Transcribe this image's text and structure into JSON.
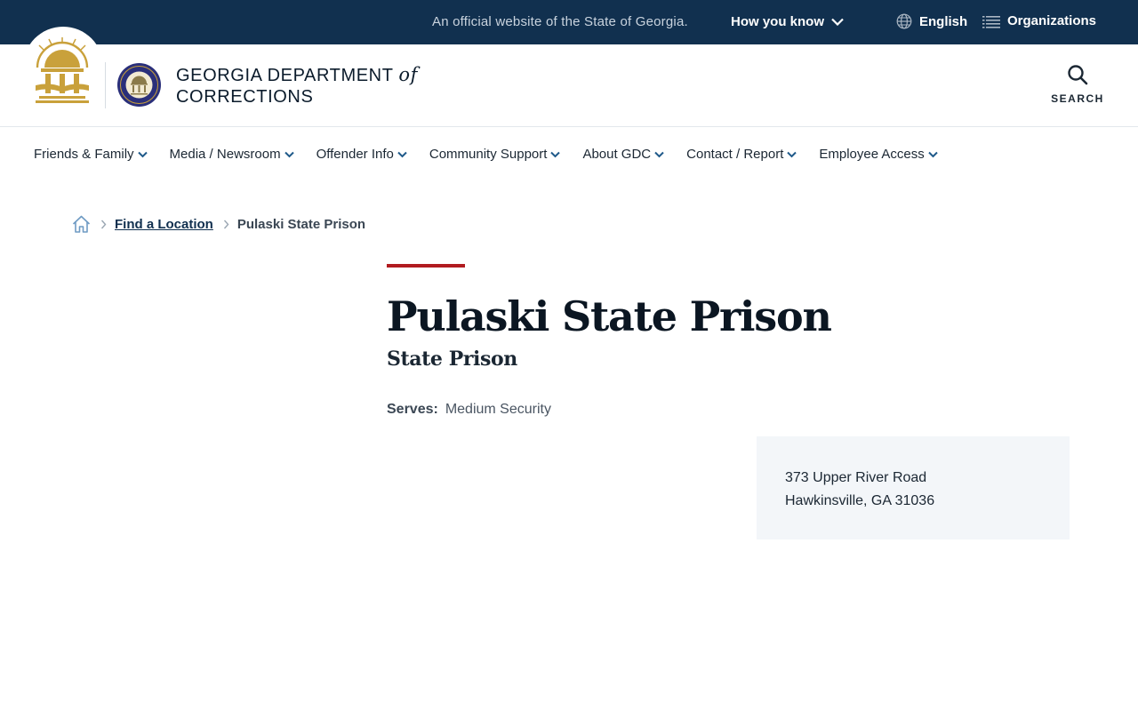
{
  "topbar": {
    "official_text": "An official website of the State of Georgia.",
    "how_you_know": "How you know",
    "language": "English",
    "organizations": "Organizations"
  },
  "header": {
    "title_line1": "GEORGIA DEPARTMENT",
    "title_of": "of",
    "title_line2": "CORRECTIONS",
    "search_label": "SEARCH"
  },
  "nav": {
    "items": [
      {
        "label": "Friends & Family"
      },
      {
        "label": "Media / Newsroom"
      },
      {
        "label": "Offender Info"
      },
      {
        "label": "Community Support"
      },
      {
        "label": "About GDC"
      },
      {
        "label": "Contact / Report"
      },
      {
        "label": "Employee Access"
      }
    ]
  },
  "breadcrumb": {
    "link": "Find a Location",
    "current": "Pulaski State Prison"
  },
  "page": {
    "title": "Pulaski State Prison",
    "subtitle": "State Prison",
    "serves_label": "Serves:",
    "serves_value": "Medium Security"
  },
  "address": {
    "line1": "373 Upper River Road",
    "line2": "Hawkinsville, GA 31036"
  },
  "colors": {
    "topbar_bg": "#11304f",
    "accent_red": "#b11b1f",
    "seal_gold": "#c9a13b",
    "seal_navy": "#2a2f7a",
    "card_bg": "#f3f6f9"
  },
  "icons": {
    "state_seal": "georgia-state-seal-icon",
    "gdc_seal": "gdc-seal-icon",
    "search": "search-icon",
    "globe": "globe-icon",
    "list": "list-icon",
    "chevron": "chevron-down-icon",
    "home": "home-icon",
    "breadcrumb_sep": "chevron-right-icon"
  }
}
